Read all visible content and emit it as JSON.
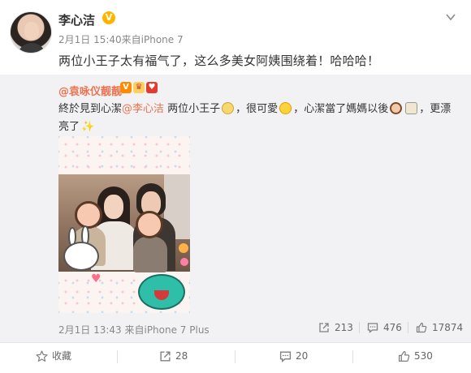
{
  "post": {
    "author": "李心洁",
    "meta": "2月1日 15:40来自iPhone 7",
    "text": "两位小王子太有福气了，这么多美女阿姨围绕着！哈哈哈！"
  },
  "repost": {
    "author": "@袁咏仪靓靓",
    "text_a": "終於見到心潔",
    "mention": "@李心洁",
    "text_b": " 两位小王子",
    "text_c": "，很可愛",
    "text_d": "，心潔當了媽媽以後",
    "text_e": "，更漂亮了",
    "text_f": "。",
    "meta": "2月1日 13:43 来自iPhone 7 Plus",
    "reposts": "213",
    "comments": "476",
    "likes": "17874"
  },
  "actions": {
    "favorite_label": "收藏",
    "repost_count": "28",
    "comment_count": "20",
    "like_count": "530"
  },
  "icons": {
    "vip": "verified-v-icon",
    "chevron": "chevron-down-icon",
    "repost": "repost-icon",
    "comment": "comment-icon",
    "like": "thumbs-up-icon",
    "favorite": "star-icon"
  },
  "colors": {
    "accent": "#eb7350",
    "vip": "#ffb400",
    "repost_bg": "#f2f2f5"
  }
}
